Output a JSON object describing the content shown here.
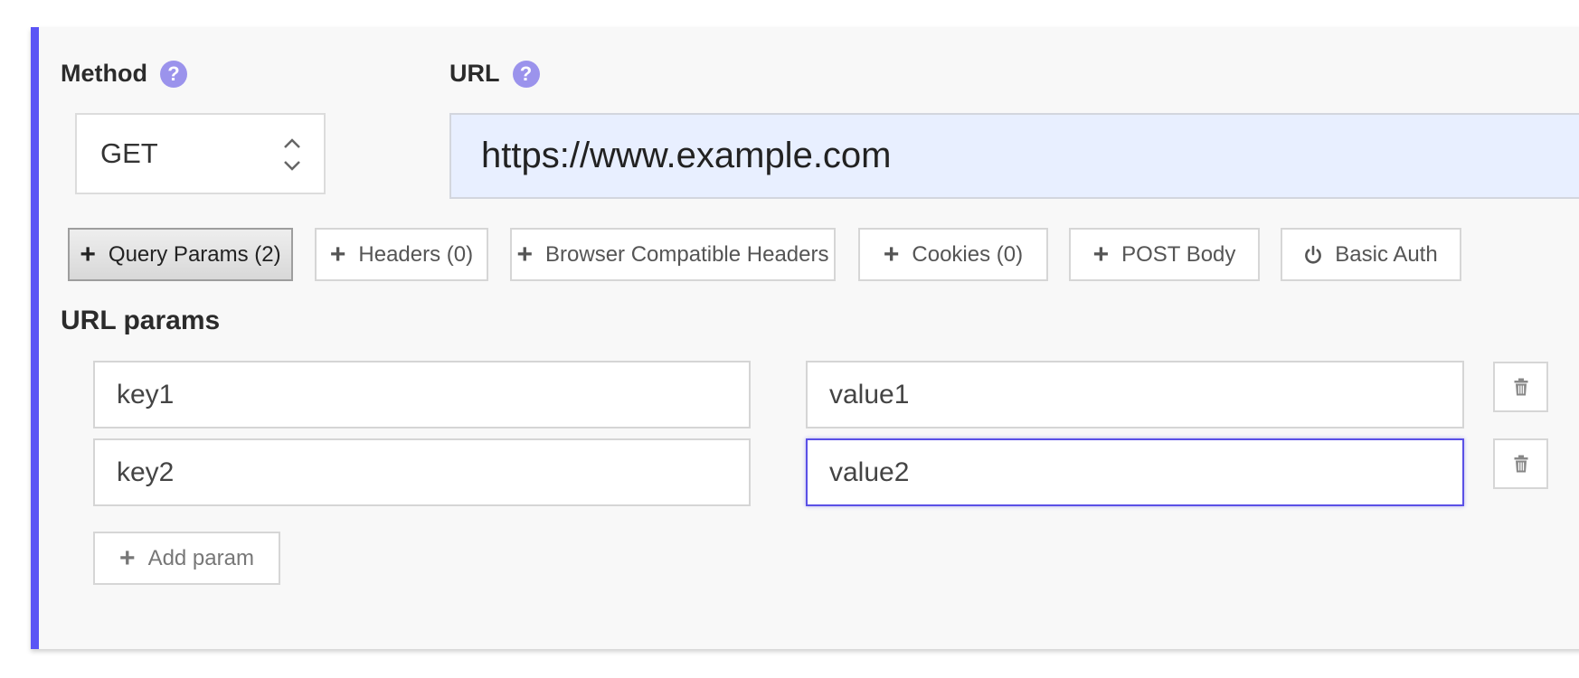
{
  "method": {
    "label": "Method",
    "help_icon": "?",
    "value": "GET"
  },
  "url": {
    "label": "URL",
    "help_icon": "?",
    "value": "https://www.example.com"
  },
  "tabs": [
    {
      "label": "Query Params (2)",
      "icon": "plus-icon",
      "active": true
    },
    {
      "label": "Headers (0)",
      "icon": "plus-icon",
      "active": false
    },
    {
      "label": "Browser Compatible Headers",
      "icon": "plus-icon",
      "active": false
    },
    {
      "label": "Cookies (0)",
      "icon": "plus-icon",
      "active": false
    },
    {
      "label": "POST Body",
      "icon": "plus-icon",
      "active": false
    },
    {
      "label": "Basic Auth",
      "icon": "power-icon",
      "active": false
    }
  ],
  "params": {
    "title": "URL params",
    "rows": [
      {
        "key": "key1",
        "value": "value1"
      },
      {
        "key": "key2",
        "value": "value2"
      }
    ],
    "add_label": "Add param"
  },
  "colors": {
    "accent": "#5b55f5",
    "url_background": "#e8efff",
    "help_icon": "#9b93ec"
  }
}
